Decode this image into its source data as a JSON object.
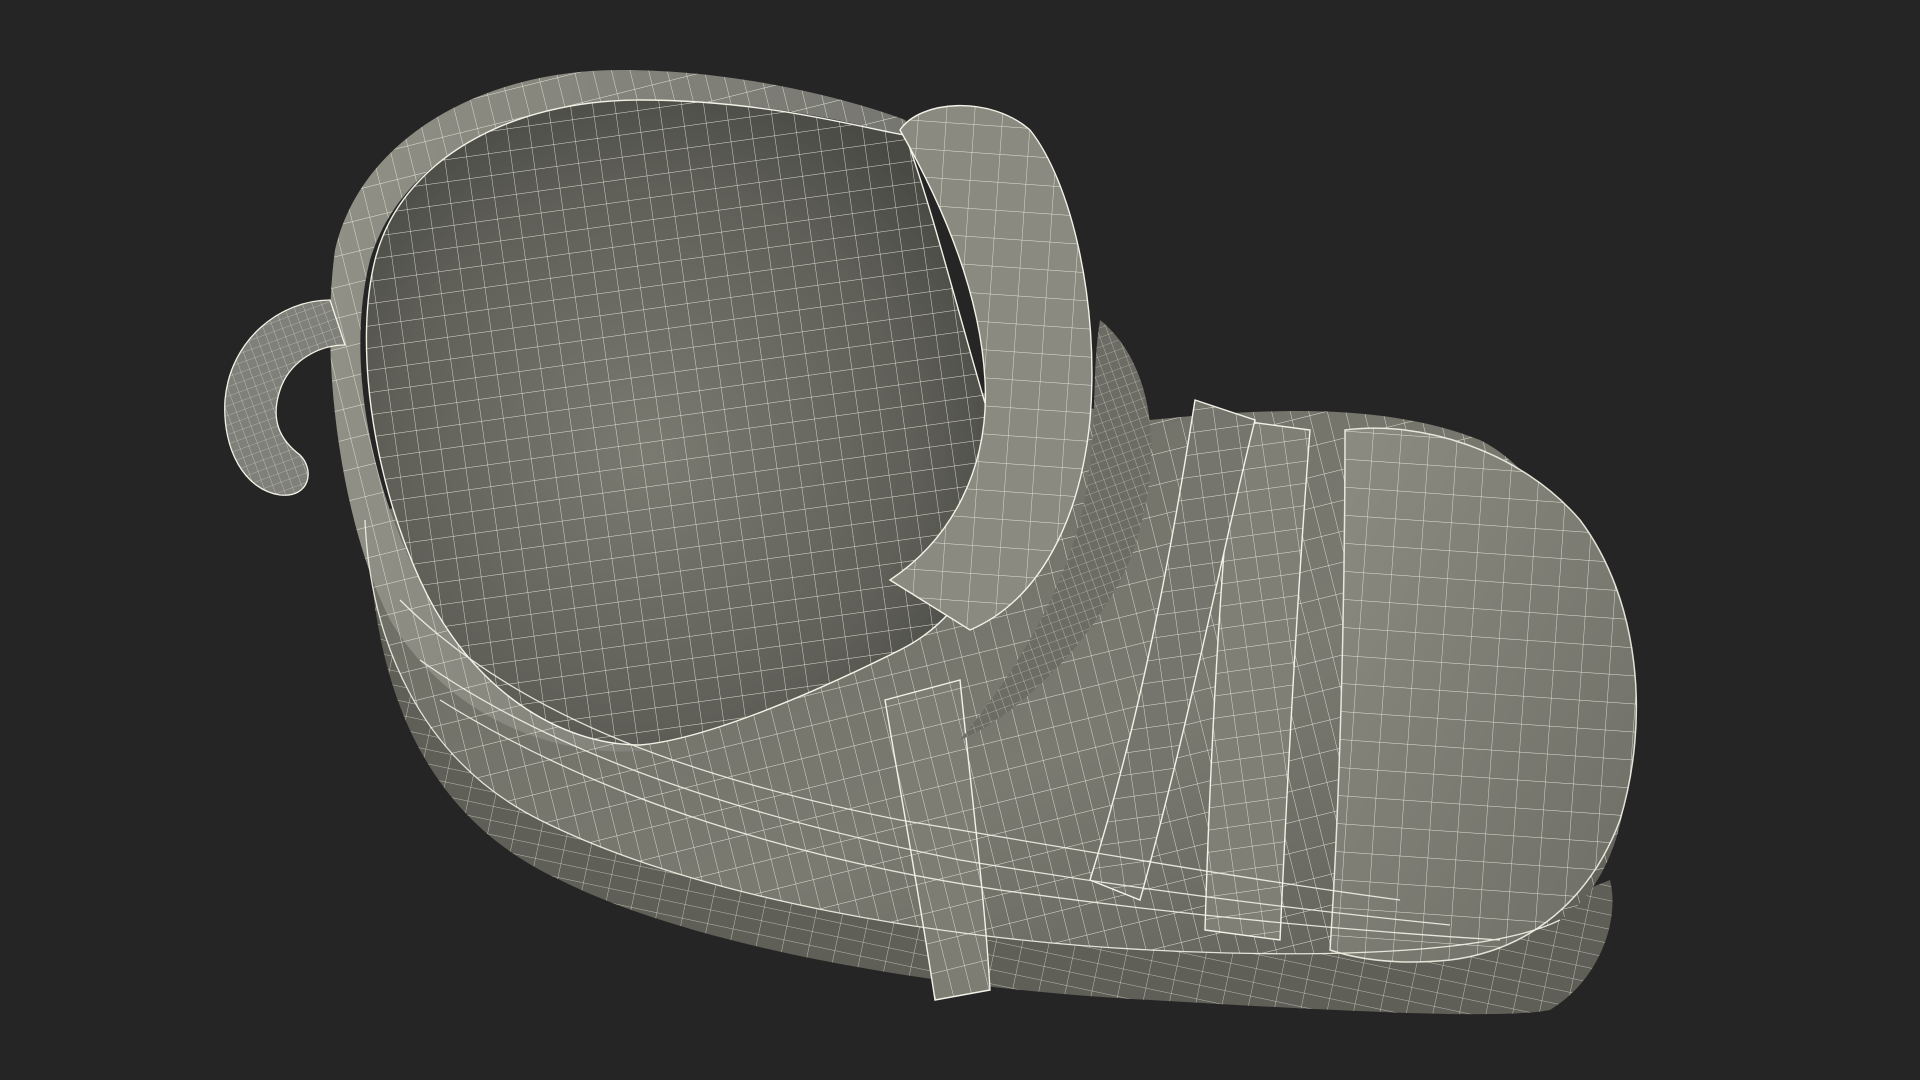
{
  "scene": {
    "subject": "boot-wireframe",
    "colors": {
      "background": "#252525",
      "surface": "#7c7c72",
      "surface_light": "#8e8e84",
      "surface_dark": "#5a5a53",
      "interior": "#6f6f67",
      "wire": "#f2f2e6"
    }
  }
}
